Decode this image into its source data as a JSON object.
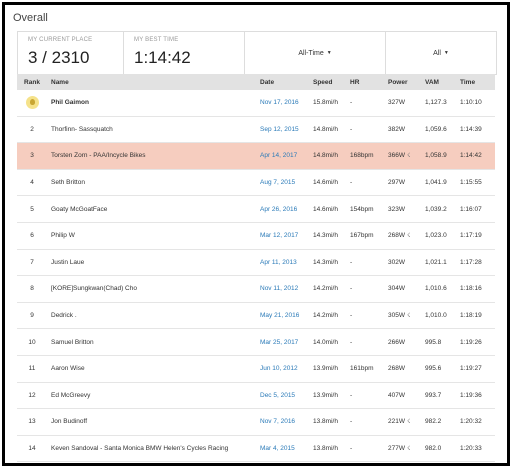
{
  "header": {
    "title": "Overall"
  },
  "stats": {
    "current_place_label": "MY CURRENT PLACE",
    "current_place_value": "3 / 2310",
    "best_time_label": "MY BEST TIME",
    "best_time_value": "1:14:42",
    "time_filter": "All-Time",
    "group_filter": "All"
  },
  "table": {
    "columns": [
      "Rank",
      "Name",
      "Date",
      "Speed",
      "HR",
      "Power",
      "VAM",
      "Time"
    ],
    "rows": [
      {
        "rank": "",
        "name": "Phil Gaimon",
        "date": "Nov 17, 2016",
        "speed": "15.8mi/h",
        "hr": "-",
        "power": "327W",
        "power_icon": false,
        "vam": "1,127.3",
        "time": "1:10:10",
        "crown": true
      },
      {
        "rank": "2",
        "name": "Thorfinn- Sassquatch",
        "date": "Sep 12, 2015",
        "speed": "14.8mi/h",
        "hr": "-",
        "power": "382W",
        "power_icon": false,
        "vam": "1,059.6",
        "time": "1:14:39"
      },
      {
        "rank": "3",
        "name": "Torsten Zorn - PAA/Incycle Bikes",
        "date": "Apr 14, 2017",
        "speed": "14.8mi/h",
        "hr": "168bpm",
        "power": "366W",
        "power_icon": true,
        "vam": "1,058.9",
        "time": "1:14:42",
        "highlight": true
      },
      {
        "rank": "4",
        "name": "Seth Britton",
        "date": "Aug 7, 2015",
        "speed": "14.6mi/h",
        "hr": "-",
        "power": "297W",
        "power_icon": false,
        "vam": "1,041.9",
        "time": "1:15:55"
      },
      {
        "rank": "5",
        "name": "Goaty McGoatFace",
        "date": "Apr 26, 2016",
        "speed": "14.6mi/h",
        "hr": "154bpm",
        "power": "323W",
        "power_icon": false,
        "vam": "1,039.2",
        "time": "1:16:07"
      },
      {
        "rank": "6",
        "name": "Philip W",
        "date": "Mar 12, 2017",
        "speed": "14.3mi/h",
        "hr": "167bpm",
        "power": "268W",
        "power_icon": true,
        "vam": "1,023.0",
        "time": "1:17:19"
      },
      {
        "rank": "7",
        "name": "Justin Laue",
        "date": "Apr 11, 2013",
        "speed": "14.3mi/h",
        "hr": "-",
        "power": "302W",
        "power_icon": false,
        "vam": "1,021.1",
        "time": "1:17:28"
      },
      {
        "rank": "8",
        "name": "[KORE]Sungkwan(Chad) Cho",
        "date": "Nov 11, 2012",
        "speed": "14.2mi/h",
        "hr": "-",
        "power": "304W",
        "power_icon": false,
        "vam": "1,010.6",
        "time": "1:18:16"
      },
      {
        "rank": "9",
        "name": "Dedrick .",
        "date": "May 21, 2016",
        "speed": "14.2mi/h",
        "hr": "-",
        "power": "305W",
        "power_icon": true,
        "vam": "1,010.0",
        "time": "1:18:19"
      },
      {
        "rank": "10",
        "name": "Samuel Britton",
        "date": "Mar 25, 2017",
        "speed": "14.0mi/h",
        "hr": "-",
        "power": "266W",
        "power_icon": false,
        "vam": "995.8",
        "time": "1:19:26"
      },
      {
        "rank": "11",
        "name": "Aaron Wise",
        "date": "Jun 10, 2012",
        "speed": "13.9mi/h",
        "hr": "161bpm",
        "power": "268W",
        "power_icon": false,
        "vam": "995.6",
        "time": "1:19:27"
      },
      {
        "rank": "12",
        "name": "Ed McGreevy",
        "date": "Dec 5, 2015",
        "speed": "13.9mi/h",
        "hr": "-",
        "power": "407W",
        "power_icon": false,
        "vam": "993.7",
        "time": "1:19:36"
      },
      {
        "rank": "13",
        "name": "Jon Budinoff",
        "date": "Nov 7, 2016",
        "speed": "13.8mi/h",
        "hr": "-",
        "power": "221W",
        "power_icon": true,
        "vam": "982.2",
        "time": "1:20:32"
      },
      {
        "rank": "14",
        "name": "Keven Sandoval - Santa Monica BMW Helen's Cycles Racing",
        "date": "Mar 4, 2015",
        "speed": "13.8mi/h",
        "hr": "-",
        "power": "277W",
        "power_icon": true,
        "vam": "982.0",
        "time": "1:20:33"
      }
    ]
  },
  "icons": {
    "crown": "crown-icon",
    "power": "power-meter-icon",
    "dropdown": "chevron-down-icon"
  },
  "colors": {
    "highlight_row": "#f6cdbf",
    "link": "#2a7ab8",
    "header_bg": "#e2e2e2"
  }
}
